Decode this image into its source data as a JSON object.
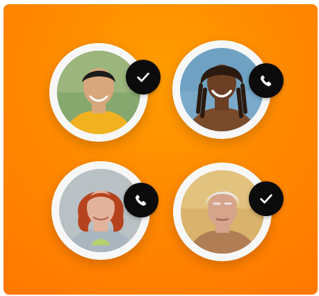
{
  "contacts": [
    {
      "status": "verified",
      "status_icon": "checkmark-icon",
      "bg": "#7aa36a",
      "skin": "#d8a77c",
      "hair": "#1b1b1b",
      "shirt": "#f2b21f"
    },
    {
      "status": "calling",
      "status_icon": "phone-icon",
      "bg": "#6fa1c2",
      "skin": "#6b3f24",
      "hair": "#2b1a10",
      "shirt": "#7a4b2a"
    },
    {
      "status": "calling",
      "status_icon": "phone-icon",
      "bg": "#b9c1c4",
      "skin": "#e3b29a",
      "hair": "#b5431e",
      "shirt": "#a9b6c0"
    },
    {
      "status": "verified",
      "status_icon": "checkmark-icon",
      "bg": "#d9b26b",
      "skin": "#d6a48b",
      "hair": "#e9e6e0",
      "shirt": "#b07d55"
    }
  ],
  "colors": {
    "card_gradient_center": "#ff9c00",
    "card_gradient_edge": "#ff7700",
    "badge": "#0b0b0b",
    "ring": "#f7f7f7"
  }
}
